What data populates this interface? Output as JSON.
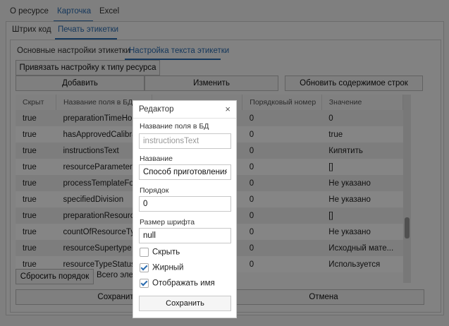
{
  "top_tabs": [
    "О ресурсе",
    "Карточка",
    "Excel"
  ],
  "sub_tabs": [
    "Штрих код",
    "Печать этикетки"
  ],
  "inner_tabs": [
    "Основные настройки этикетки",
    "Настройка текста этикетки"
  ],
  "buttons": {
    "bind": "Привязать настройку к типу ресурса",
    "add": "Добавить",
    "edit": "Изменить",
    "sync": "Обновить содержимое строк",
    "reset_order": "Сбросить порядок",
    "save": "Сохранить",
    "cancel": "Отмена"
  },
  "total_label": "Всего эле",
  "table": {
    "headers": [
      "Скрыт",
      "Название поля в БД",
      "",
      "Порядковый номер",
      "Значение"
    ],
    "rows": [
      [
        "true",
        "preparationTimeHours",
        "",
        "0",
        "0"
      ],
      [
        "true",
        "hasApprovedCalibration",
        "",
        "0",
        "true"
      ],
      [
        "true",
        "instructionsText",
        "",
        "0",
        "Кипятить"
      ],
      [
        "true",
        "resourceParameters",
        "",
        "0",
        "[]"
      ],
      [
        "true",
        "processTemplateForm",
        "",
        "0",
        "Не указано"
      ],
      [
        "true",
        "specifiedDivision",
        "",
        "0",
        "Не указано"
      ],
      [
        "true",
        "preparationResources",
        "",
        "0",
        "[]"
      ],
      [
        "true",
        "countOfResourceType",
        "",
        "0",
        "Не указано"
      ],
      [
        "true",
        "resourceSupertype",
        "",
        "0",
        "Исходный мате..."
      ],
      [
        "true",
        "resourceTypeStatus",
        "",
        "0",
        "Используется"
      ]
    ]
  },
  "dialog": {
    "title": "Редактор",
    "close": "×",
    "field_db_label": "Название поля в БД",
    "field_db_value": "instructionsText",
    "name_label": "Название",
    "name_value": "Способ приготовления",
    "order_label": "Порядок",
    "order_value": "0",
    "font_label": "Размер шрифта",
    "font_value": "null",
    "hide_label": "Скрыть",
    "hide_checked": false,
    "bold_label": "Жирный",
    "bold_checked": true,
    "show_name_label": "Отображать имя",
    "show_name_checked": true,
    "save_label": "Сохранить"
  },
  "colors": {
    "accent": "#2b6cb0",
    "overlay": "rgba(0,0,0,0.48)"
  }
}
